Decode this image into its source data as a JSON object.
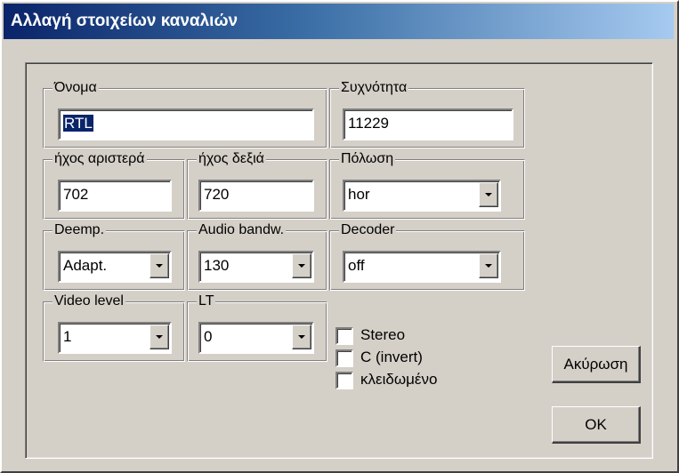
{
  "window": {
    "title": "Αλλαγή στοιχείων καναλιών"
  },
  "fields": {
    "name": {
      "label": "Όνομα",
      "value": "RTL"
    },
    "frequency": {
      "label": "Συχνότητα",
      "value": "11229"
    },
    "audio_left": {
      "label": "ήχος αριστερά",
      "value": "702"
    },
    "audio_right": {
      "label": "ήχος δεξιά",
      "value": "720"
    },
    "polarization": {
      "label": "Πόλωση",
      "value": "hor"
    },
    "deemphasis": {
      "label": "Deemp.",
      "value": "Adapt."
    },
    "audio_bandwidth": {
      "label": "Audio bandw.",
      "value": "130"
    },
    "decoder": {
      "label": "Decoder",
      "value": "off"
    },
    "video_level": {
      "label": "Video level",
      "value": "1"
    },
    "lt": {
      "label": "LT",
      "value": "0"
    }
  },
  "checkboxes": {
    "stereo": {
      "label": "Stereo",
      "checked": false
    },
    "c_invert": {
      "label": "C (invert)",
      "checked": false
    },
    "locked": {
      "label": "κλειδωμένο",
      "checked": false
    }
  },
  "buttons": {
    "cancel": "Ακύρωση",
    "ok": "OK"
  },
  "colors": {
    "titlebar_start": "#0a246a",
    "titlebar_end": "#a6caf0",
    "face": "#d4d0c8"
  }
}
